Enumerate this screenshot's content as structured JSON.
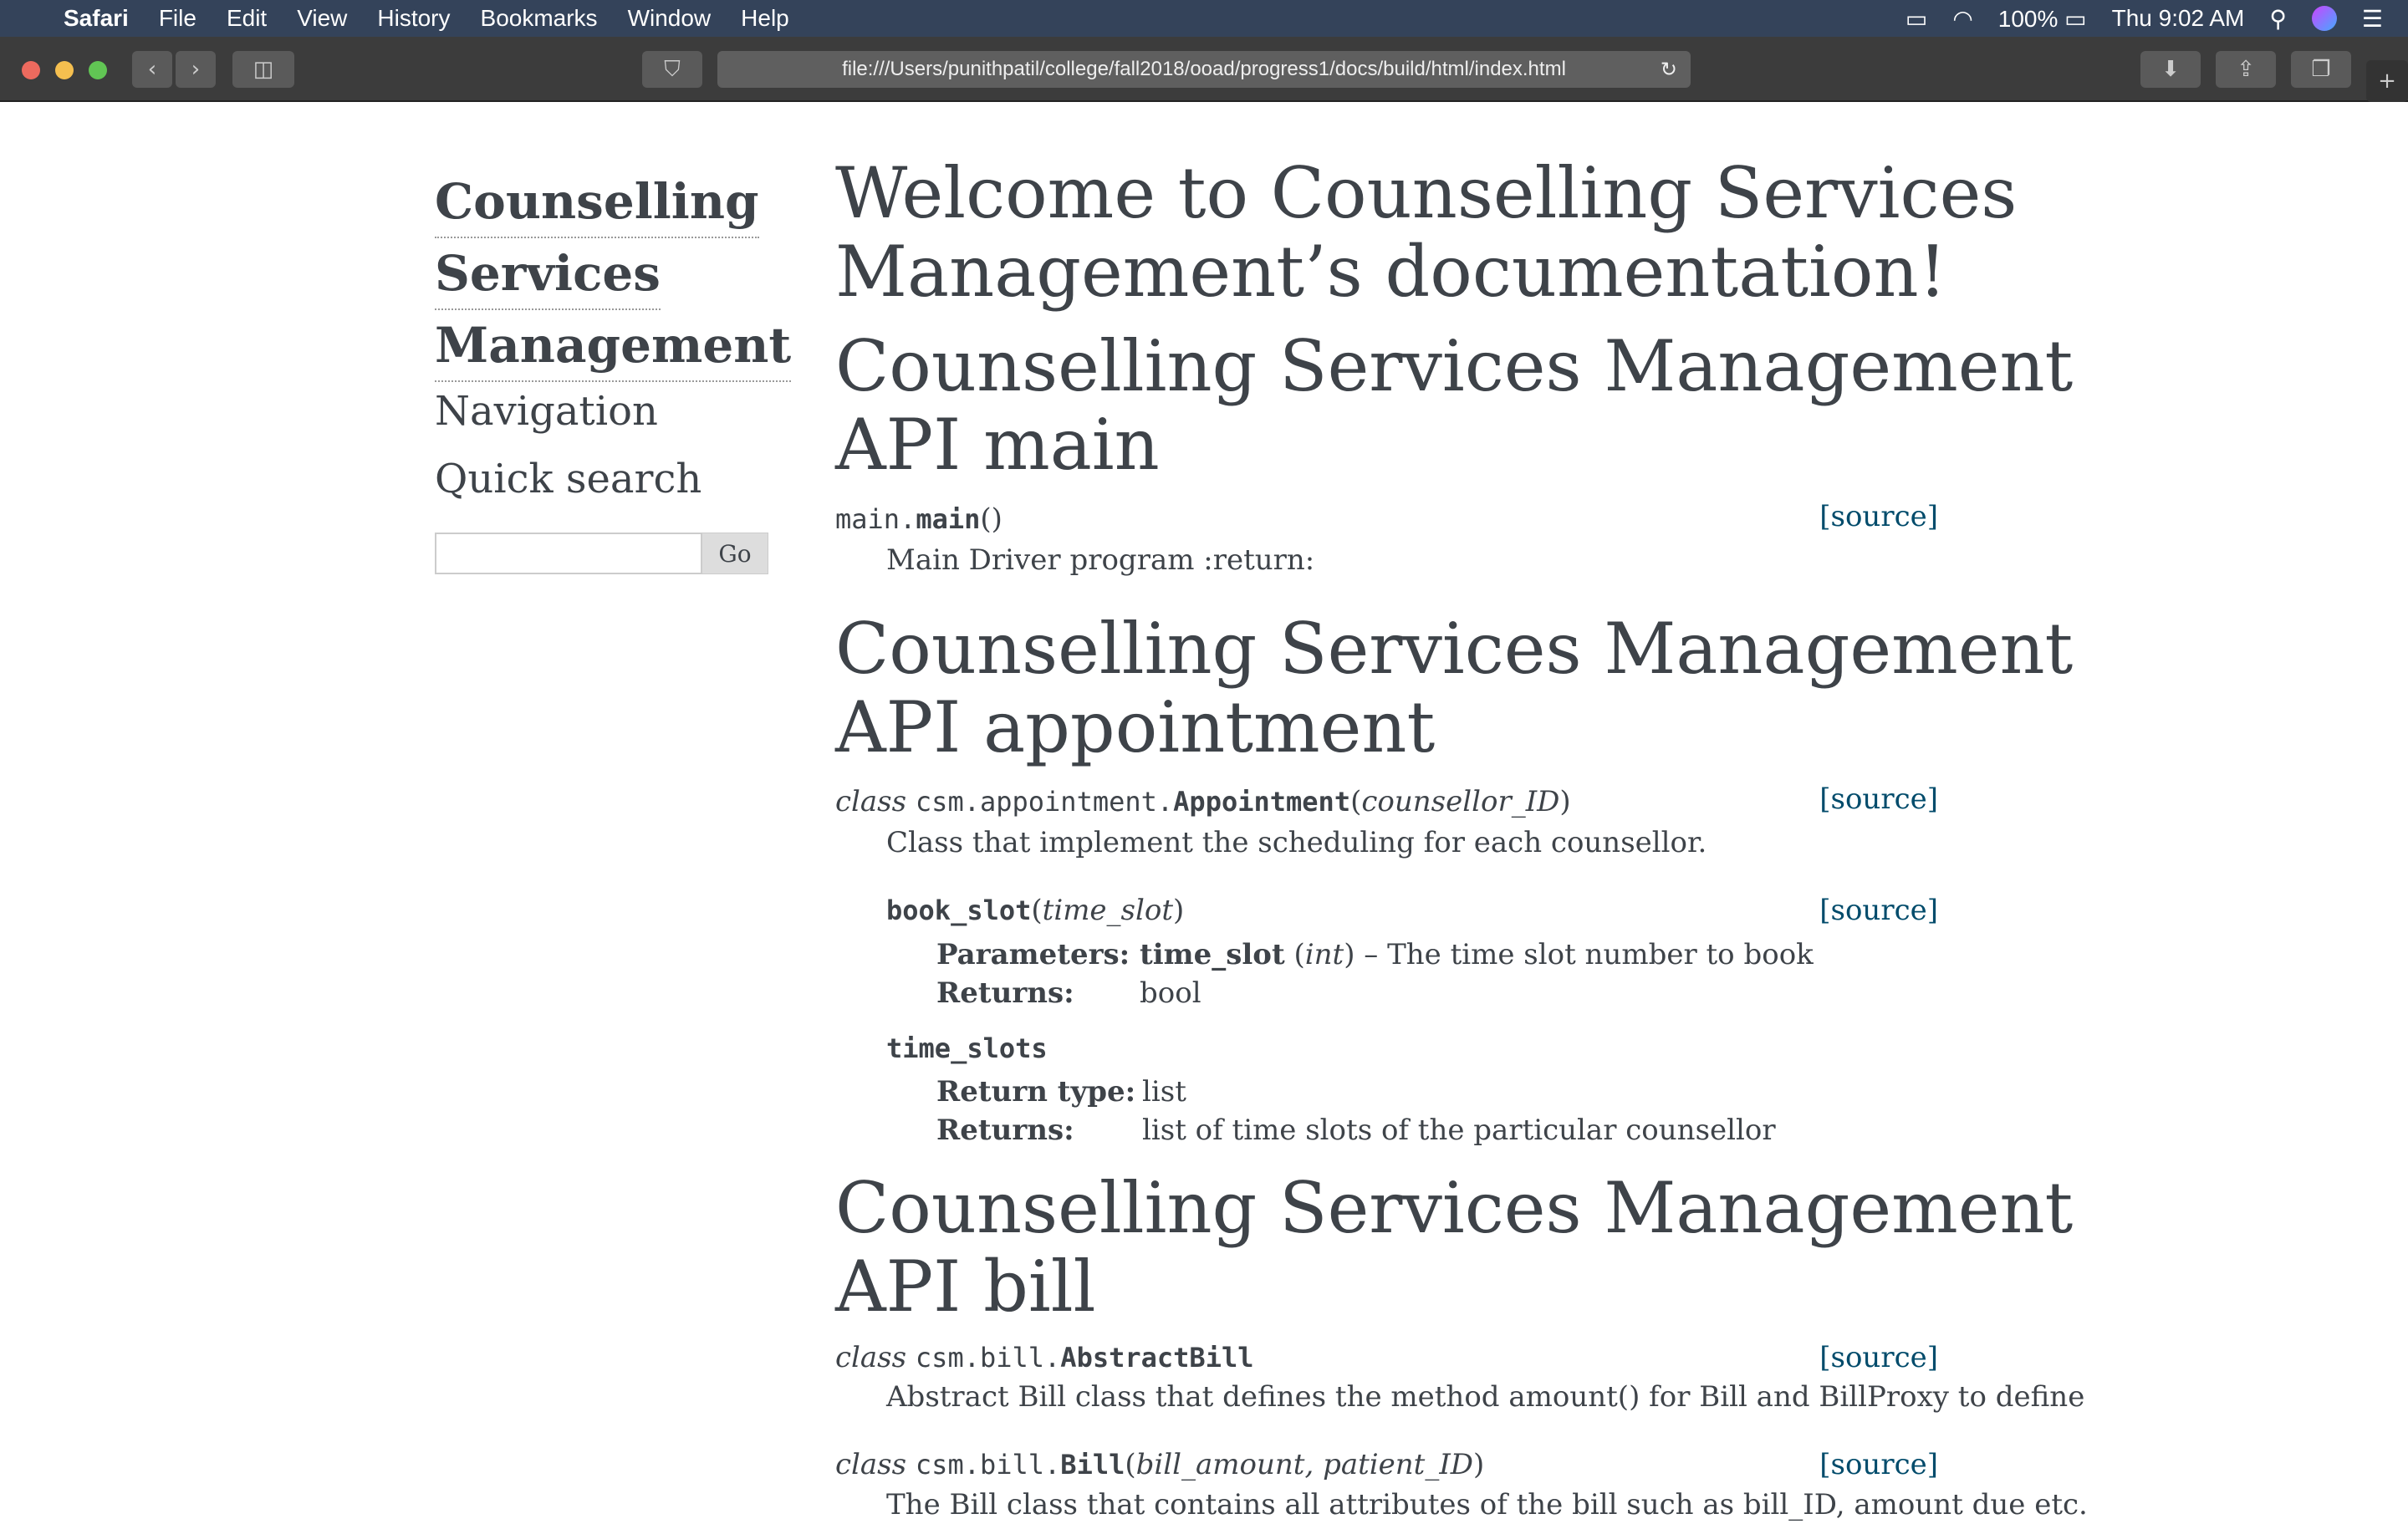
{
  "menubar": {
    "app": "Safari",
    "items": [
      "File",
      "Edit",
      "View",
      "History",
      "Bookmarks",
      "Window",
      "Help"
    ],
    "battery": "100%",
    "clock": "Thu 9:02 AM"
  },
  "toolbar": {
    "url": "file:///Users/punithpatil/college/fall2018/ooad/progress1/docs/build/html/index.html"
  },
  "sidebar": {
    "title": [
      "Counselling",
      "Services",
      "Management"
    ],
    "navigation": "Navigation",
    "quick_search": "Quick search",
    "search_value": "",
    "go": "Go"
  },
  "main": {
    "h1": [
      "Welcome to Counselling Services",
      "Management’s documentation!"
    ],
    "source": "[source]",
    "sec_main": {
      "title": [
        "Counselling Services Management",
        "API main"
      ],
      "sig_mod": "main.",
      "sig_name": "main",
      "sig_args": "()",
      "desc": "Main Driver program :return:"
    },
    "sec_appt": {
      "title": [
        "Counselling Services Management",
        "API appointment"
      ],
      "cls": "class",
      "mod": "csm.appointment.",
      "name": "Appointment",
      "arg": "counsellor_ID",
      "desc": "Class that implement the scheduling for each counsellor.",
      "book_slot": {
        "name": "book_slot",
        "arg": "time_slot",
        "params_label": "Parameters:",
        "param_name": "time_slot",
        "param_type": "int",
        "param_desc": " – The time slot number to book",
        "returns_label": "Returns:",
        "returns": "bool"
      },
      "time_slots": {
        "name": "time_slots",
        "rtype_label": "Return type:",
        "rtype": "list",
        "returns_label": "Returns:",
        "returns": "list of time slots of the particular counsellor"
      }
    },
    "sec_bill": {
      "title": [
        "Counselling Services Management",
        "API bill"
      ],
      "cls": "class",
      "mod": "csm.bill.",
      "abstract_name": "AbstractBill",
      "abstract_desc": "Abstract Bill class that defines the method amount() for Bill and BillProxy to define",
      "bill_name": "Bill",
      "bill_args": "bill_amount, patient_ID",
      "bill_desc": "The Bill class that contains all attributes of the bill such as bill_ID, amount due etc."
    }
  }
}
